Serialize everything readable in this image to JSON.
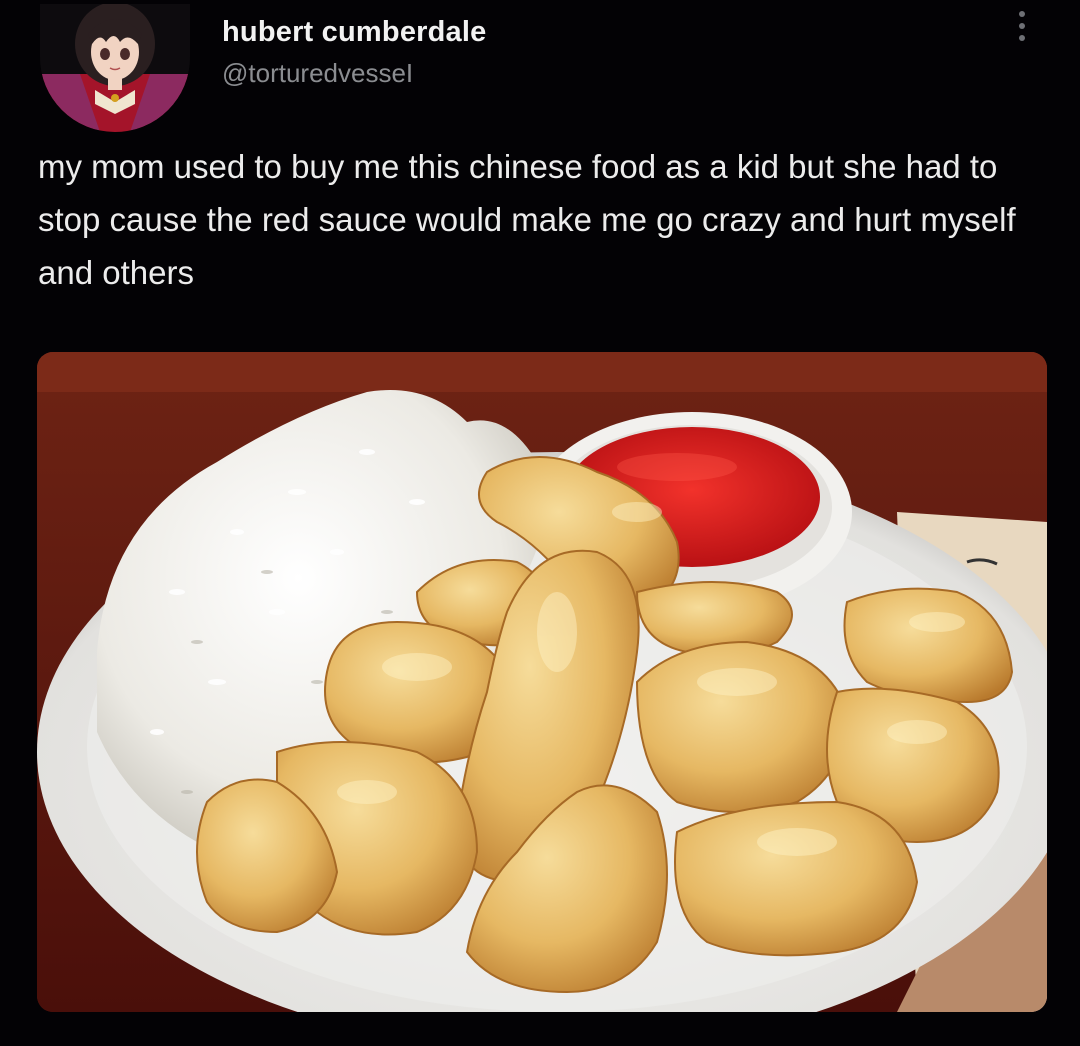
{
  "tweet": {
    "author": {
      "display_name": "hubert cumberdale",
      "handle": "@torturedvesseI",
      "avatar_icon": "anime-avatar"
    },
    "more_icon": "more-vertical-icon",
    "text": "my mom used to buy me this chinese food as a kid but she had to stop cause the red sauce would make me go crazy and hurt myself and others",
    "media": {
      "icon": "food-photo",
      "depicts": [
        "white-plate",
        "white-rice",
        "sweet-and-sour-sauce-cup",
        "battered-fried-chicken"
      ]
    }
  },
  "colors": {
    "background": "#030205",
    "name": "#f2f2f2",
    "handle": "#8b8d91",
    "text": "#ececec",
    "sauce": "#d8171d",
    "batter": "#e2b668"
  }
}
